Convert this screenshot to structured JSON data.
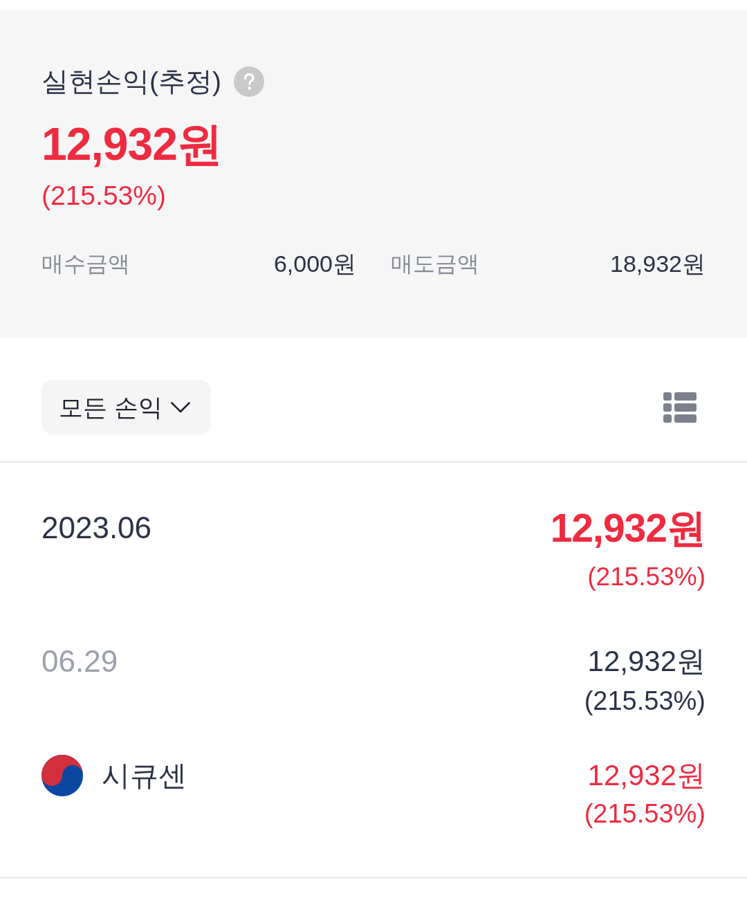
{
  "summary": {
    "title": "실현손익(추정)",
    "amount": "12,932원",
    "rate": "(215.53%)",
    "gain": true,
    "stats": [
      {
        "label": "매수금액",
        "value": "6,000원"
      },
      {
        "label": "매도금액",
        "value": "18,932원"
      }
    ]
  },
  "filter": {
    "label": "모든 손익"
  },
  "rows": [
    {
      "kind": "month",
      "label": "2023.06",
      "amount": "12,932원",
      "rate": "(215.53%)",
      "gain": true
    },
    {
      "kind": "day",
      "label": "06.29",
      "amount": "12,932원",
      "rate": "(215.53%)",
      "gain": false
    },
    {
      "kind": "stock",
      "label": "시큐센",
      "amount": "12,932원",
      "rate": "(215.53%)",
      "gain": true
    }
  ]
}
